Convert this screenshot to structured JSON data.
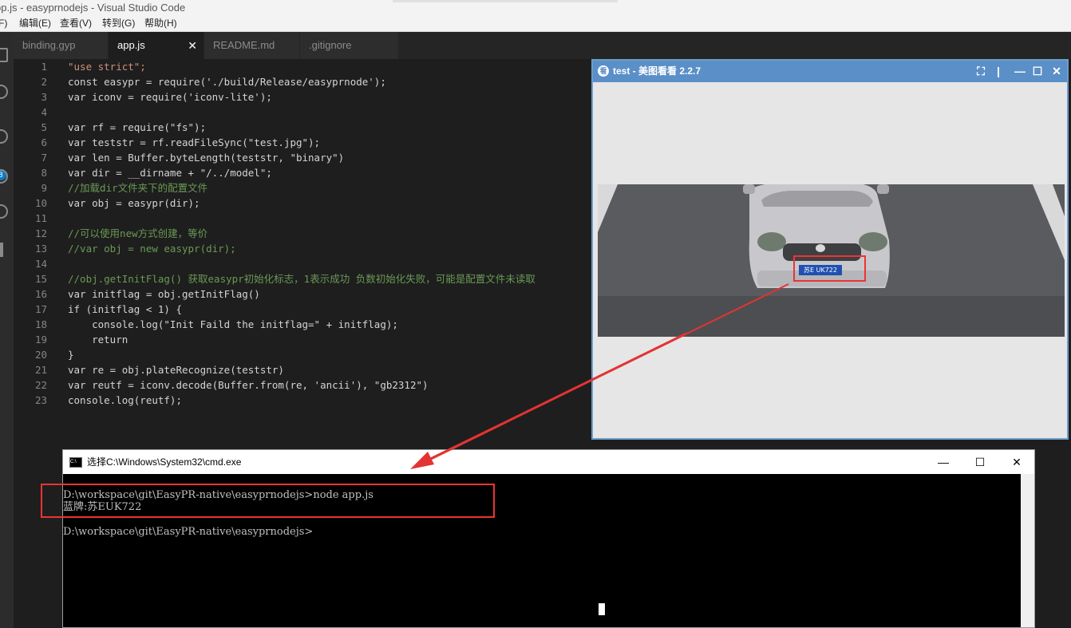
{
  "window": {
    "title": "pp.js - easyprnodejs - Visual Studio Code"
  },
  "menu": [
    "F)",
    "编辑(E)",
    "查看(V)",
    "转到(G)",
    "帮助(H)"
  ],
  "tabs": [
    {
      "label": "binding.gyp",
      "active": false
    },
    {
      "label": "app.js",
      "active": true,
      "close": "✕"
    },
    {
      "label": "README.md",
      "active": false
    },
    {
      "label": ".gitignore",
      "active": false
    }
  ],
  "activity": {
    "badge": "8"
  },
  "editor": {
    "line_numbers": [
      "1",
      "2",
      "3",
      "4",
      "5",
      "6",
      "7",
      "8",
      "9",
      "10",
      "11",
      "12",
      "13",
      "14",
      "15",
      "16",
      "17",
      "18",
      "19",
      "20",
      "21",
      "22",
      "23"
    ],
    "lines": [
      "\"use strict\";",
      "const easypr = require('./build/Release/easyprnode');",
      "var iconv = require('iconv-lite');",
      "",
      "var rf = require(\"fs\");",
      "var teststr = rf.readFileSync(\"test.jpg\");",
      "var len = Buffer.byteLength(teststr, \"binary\")",
      "var dir = __dirname + \"/../model\";",
      "//加载dir文件夹下的配置文件",
      "var obj = easypr(dir);",
      "",
      "//可以使用new方式创建，等价",
      "//var obj = new easypr(dir);",
      "",
      "//obj.getInitFlag() 获取easypr初始化标志，1表示成功 负数初始化失败，可能是配置文件未读取",
      "var initflag = obj.getInitFlag()",
      "if (initflag < 1) {",
      "    console.log(\"Init Faild the initflag=\" + initflag);",
      "    return",
      "}",
      "var re = obj.plateRecognize(teststr)",
      "var reutf = iconv.decode(Buffer.from(re, 'ancii'), \"gb2312\")",
      "console.log(reutf);"
    ]
  },
  "viewer": {
    "logo": "看",
    "title": "test - 美图看看 2.2.7",
    "buttons": {
      "fullscreen": "⛶",
      "sep": "|",
      "minimize": "—",
      "maximize": "☐",
      "close": "✕"
    },
    "plate_text": "苏E UK722"
  },
  "cmd": {
    "icon": "C:\\",
    "title": "选择C:\\Windows\\System32\\cmd.exe",
    "buttons": {
      "minimize": "—",
      "maximize": "☐",
      "close": "✕"
    },
    "lines": [
      "D:\\workspace\\git\\EasyPR-native\\easyprnodejs>node app.js",
      "蓝牌:苏EUK722",
      "",
      "D:\\workspace\\git\\EasyPR-native\\easyprnodejs>"
    ]
  },
  "annotations": {
    "highlight_color": "#e33333"
  }
}
